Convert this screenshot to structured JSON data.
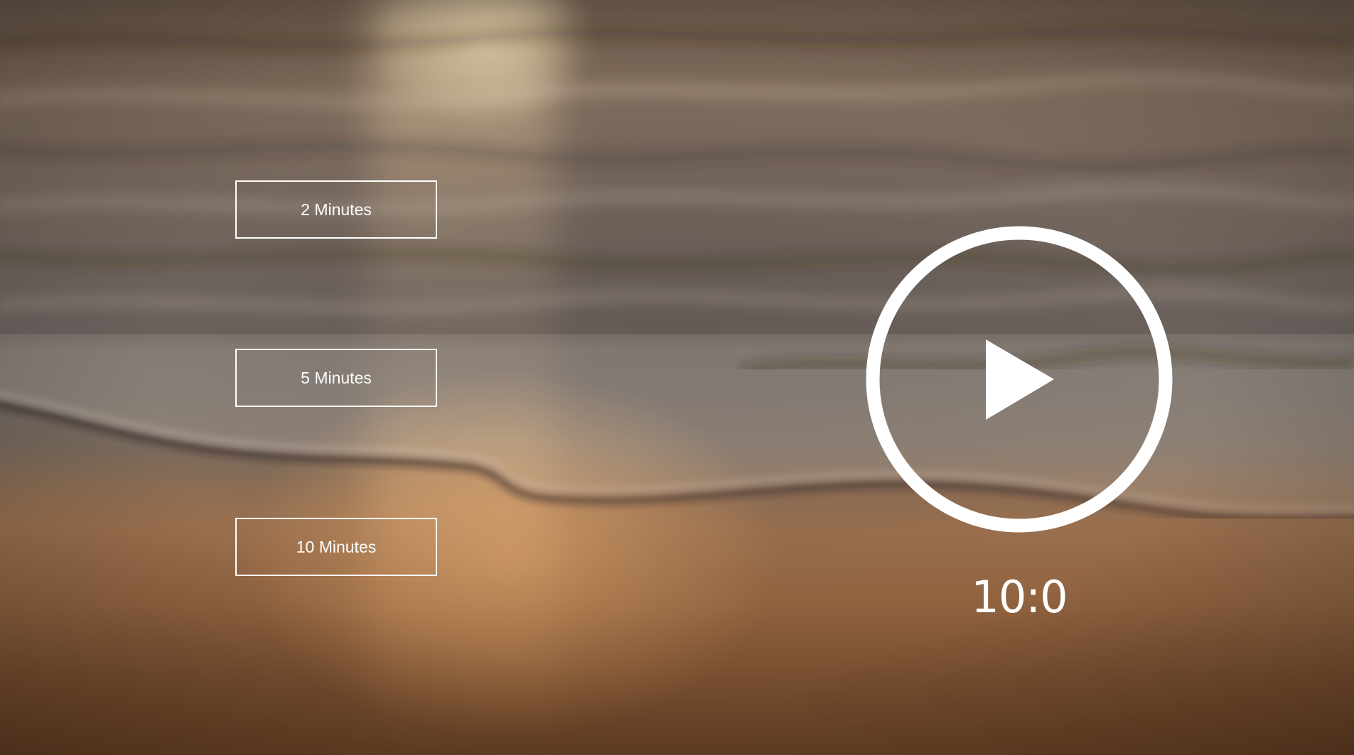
{
  "background": {
    "description_icon": "ocean-shore-sunset-image"
  },
  "durations": [
    {
      "label": "2 Minutes"
    },
    {
      "label": "5 Minutes"
    },
    {
      "label": "10 Minutes"
    }
  ],
  "player": {
    "icon": "play-circle-icon",
    "timer": "10:0"
  },
  "colors": {
    "foreground": "#ffffff"
  }
}
